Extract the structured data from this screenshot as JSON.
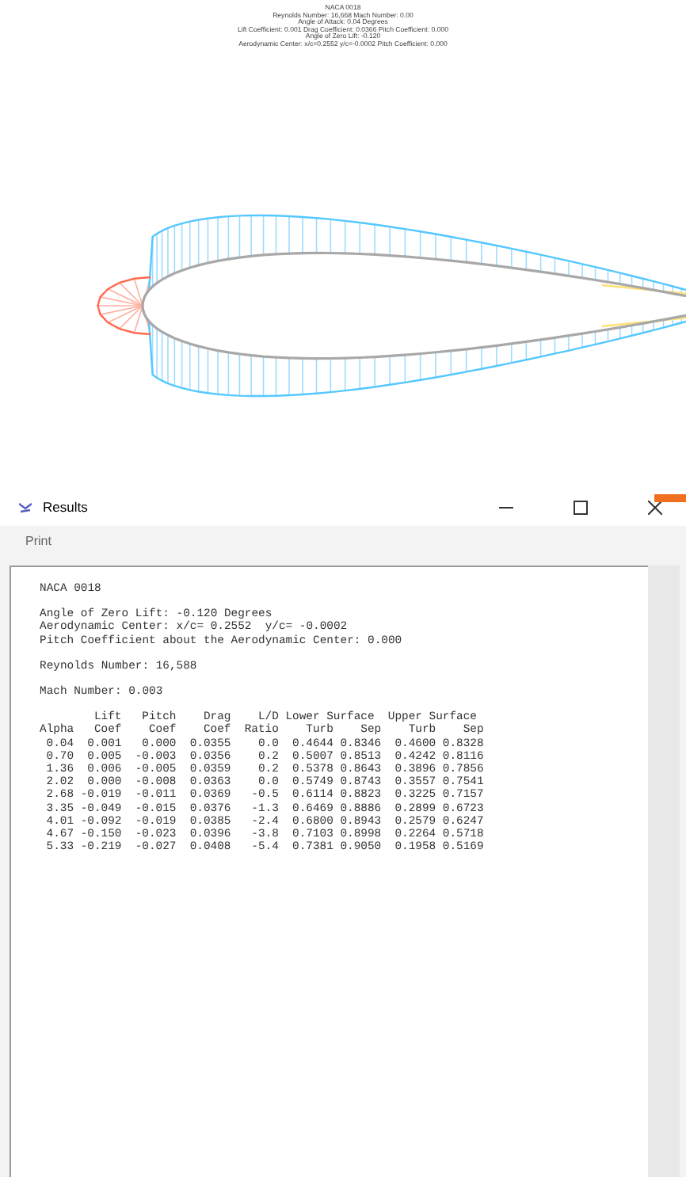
{
  "plot": {
    "header_lines": [
      "NACA 0018",
      "Reynolds Number: 16,668  Mach Number: 0.00",
      "Angle of Attack: 0.04 Degrees",
      "Lift Coefficient: 0.001  Drag Coefficient: 0.0366  Pitch Coefficient: 0.000",
      "Angle of Zero Lift: -0.120",
      "Aerodynamic Center: x/c=0.2552 y/c=-0.0002  Pitch Coefficient: 0.000"
    ]
  },
  "window": {
    "title": "Results"
  },
  "menu": [
    "Print"
  ],
  "report": {
    "title": "NACA 0018",
    "summary_lines": [
      "Angle of Zero Lift: -0.120 Degrees",
      "Aerodynamic Center: x/c= 0.2552  y/c= -0.0002",
      "Pitch Coefficient about the Aerodynamic Center: 0.000"
    ],
    "reynolds": "Reynolds Number: 16,588",
    "mach": "Mach Number: 0.003",
    "table": {
      "group_headers": [
        "Lift",
        "Pitch",
        "Drag",
        "L/D",
        "Lower Surface",
        "Upper Surface"
      ],
      "columns": [
        "Alpha",
        "Coef",
        "Coef",
        "Coef",
        "Ratio",
        "Turb",
        "Sep",
        "Turb",
        "Sep"
      ],
      "rows": [
        [
          "0.04",
          "0.001",
          "0.000",
          "0.0355",
          "0.0",
          "0.4644",
          "0.8346",
          "0.4600",
          "0.8328"
        ],
        [
          "0.70",
          "0.005",
          "-0.003",
          "0.0356",
          "0.2",
          "0.5007",
          "0.8513",
          "0.4242",
          "0.8116"
        ],
        [
          "1.36",
          "0.006",
          "-0.005",
          "0.0359",
          "0.2",
          "0.5378",
          "0.8643",
          "0.3896",
          "0.7856"
        ],
        [
          "2.02",
          "0.000",
          "-0.008",
          "0.0363",
          "0.0",
          "0.5749",
          "0.8743",
          "0.3557",
          "0.7541"
        ],
        [
          "2.68",
          "-0.019",
          "-0.011",
          "0.0369",
          "-0.5",
          "0.6114",
          "0.8823",
          "0.3225",
          "0.7157"
        ],
        [
          "3.35",
          "-0.049",
          "-0.015",
          "0.0376",
          "-1.3",
          "0.6469",
          "0.8886",
          "0.2899",
          "0.6723"
        ],
        [
          "4.01",
          "-0.092",
          "-0.019",
          "0.0385",
          "-2.4",
          "0.6800",
          "0.8943",
          "0.2579",
          "0.6247"
        ],
        [
          "4.67",
          "-0.150",
          "-0.023",
          "0.0396",
          "-3.8",
          "0.7103",
          "0.8998",
          "0.2264",
          "0.5718"
        ],
        [
          "5.33",
          "-0.219",
          "-0.027",
          "0.0408",
          "-5.4",
          "0.7381",
          "0.9050",
          "0.1958",
          "0.5169"
        ]
      ]
    }
  }
}
